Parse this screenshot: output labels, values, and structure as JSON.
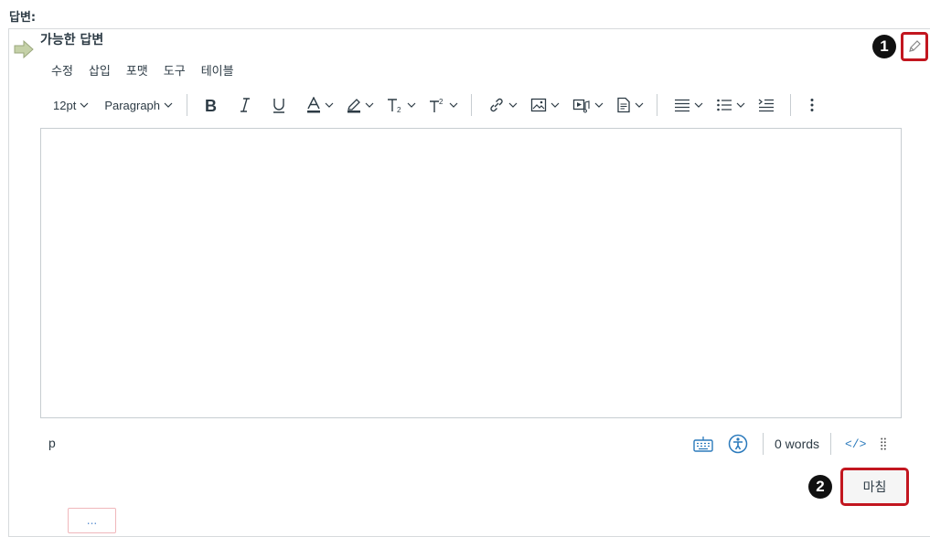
{
  "section_label": "답변:",
  "answer": {
    "title": "가능한 답변"
  },
  "callouts": {
    "one": "1",
    "two": "2"
  },
  "menubar": [
    "수정",
    "삽입",
    "포맷",
    "도구",
    "테이블"
  ],
  "toolbar": {
    "font_size": "12pt",
    "block_format": "Paragraph"
  },
  "status": {
    "path": "p",
    "word_count": "0 words",
    "html_label": "</>"
  },
  "done_label": "마침",
  "more_label": "...",
  "colors": {
    "highlight_red": "#c2161f",
    "link_blue": "#2b7abc",
    "text": "#2d3b45"
  }
}
